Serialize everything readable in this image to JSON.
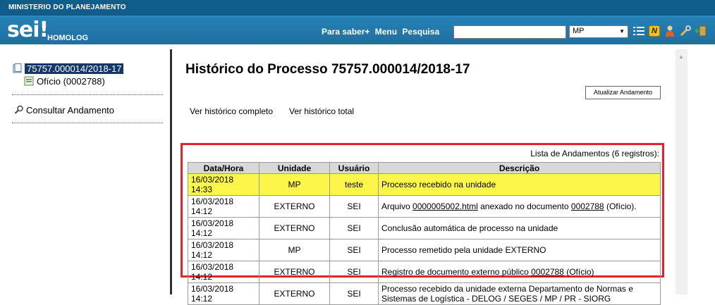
{
  "gov_bar": {
    "label": "MINISTERIO DO PLANEJAMENTO"
  },
  "header": {
    "logo": "sei!",
    "environment": "HOMOLOG",
    "nav": [
      "Para saber+",
      "Menu",
      "Pesquisa"
    ],
    "search": {
      "value": "",
      "placeholder": ""
    },
    "unit_select": {
      "selected": "MP"
    },
    "icons": [
      "list-icon",
      "n-badge-icon",
      "user-icon",
      "tools-icon",
      "exit-icon"
    ],
    "n_badge": "N"
  },
  "tree": {
    "process": "75757.000014/2018-17",
    "document": "Ofício (0002788)",
    "consult": "Consultar Andamento"
  },
  "main": {
    "title": "Histórico do Processo 75757.000014/2018-17",
    "update_button": "Atualizar Andamento",
    "links": [
      "Ver histórico completo",
      "Ver histórico total"
    ],
    "table_caption": "Lista de Andamentos (6 registros):",
    "columns": [
      "Data/Hora",
      "Unidade",
      "Usuário",
      "Descrição"
    ],
    "rows": [
      {
        "datetime": "16/03/2018 14:33",
        "unit": "MP",
        "user": "teste",
        "desc_pre": "Processo recebido na unidade",
        "link1": "",
        "desc_mid": "",
        "link2": "",
        "desc_post": "",
        "highlight": true
      },
      {
        "datetime": "16/03/2018 14:12",
        "unit": "EXTERNO",
        "user": "SEI",
        "desc_pre": "Arquivo ",
        "link1": "0000005002.html",
        "desc_mid": " anexado no documento ",
        "link2": "0002788",
        "desc_post": " (Ofício).",
        "highlight": false
      },
      {
        "datetime": "16/03/2018 14:12",
        "unit": "EXTERNO",
        "user": "SEI",
        "desc_pre": "Conclusão automática de processo na unidade",
        "link1": "",
        "desc_mid": "",
        "link2": "",
        "desc_post": "",
        "highlight": false
      },
      {
        "datetime": "16/03/2018 14:12",
        "unit": "MP",
        "user": "SEI",
        "desc_pre": "Processo remetido pela unidade EXTERNO",
        "link1": "",
        "desc_mid": "",
        "link2": "",
        "desc_post": "",
        "highlight": false
      },
      {
        "datetime": "16/03/2018 14:12",
        "unit": "EXTERNO",
        "user": "SEI",
        "desc_pre": "Registro de documento externo público ",
        "link1": "",
        "desc_mid": "",
        "link2": "0002788",
        "desc_post": " (Ofício)",
        "highlight": false
      },
      {
        "datetime": "16/03/2018 14:12",
        "unit": "EXTERNO",
        "user": "SEI",
        "desc_pre": "Processo recebido da unidade externa Departamento de Normas e Sistemas de Logística - DELOG / SEGES / MP / PR - SIORG",
        "link1": "",
        "desc_mid": "",
        "link2": "",
        "desc_post": "",
        "highlight": false
      }
    ]
  },
  "colors": {
    "header": "#1f6f9f",
    "highlight": "#fdf64a",
    "frame": "#e2232a",
    "selected": "#14386b"
  }
}
